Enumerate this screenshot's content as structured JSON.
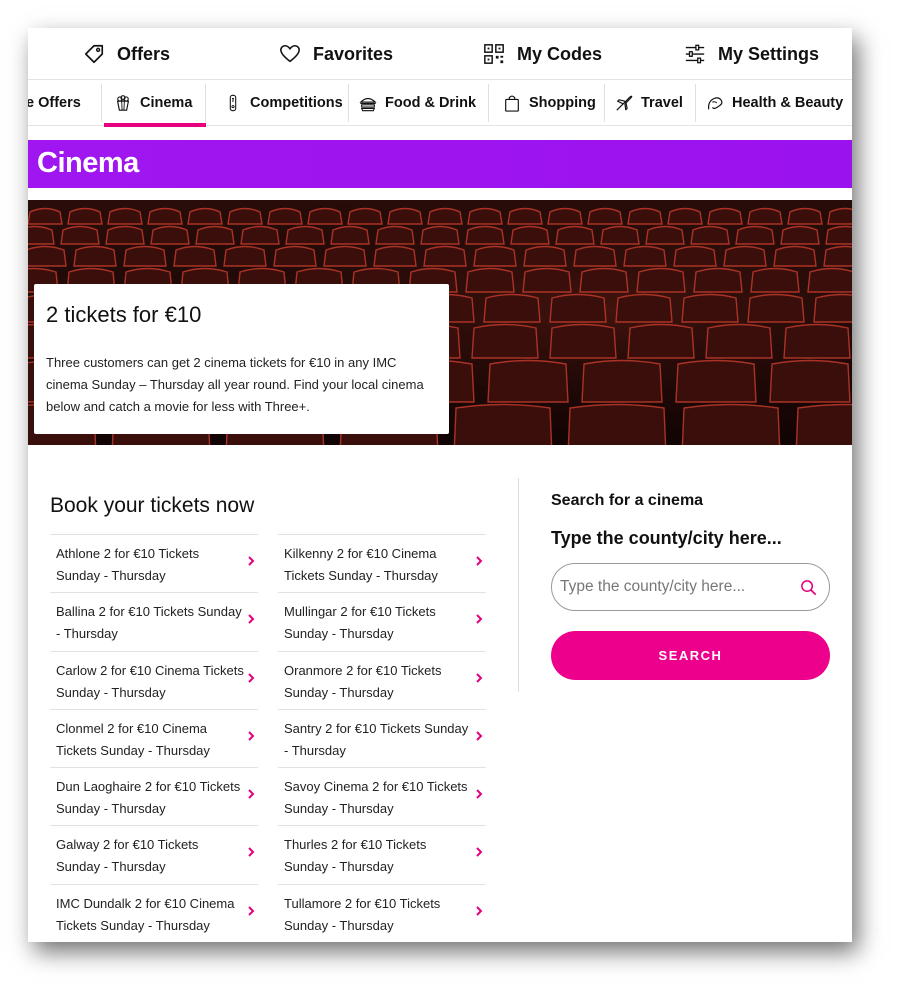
{
  "topnav": {
    "offers": "Offers",
    "favorites": "Favorites",
    "my_codes": "My Codes",
    "my_settings": "My Settings"
  },
  "categories": [
    {
      "label": "e Offers",
      "icon": "tag-icon"
    },
    {
      "label": "Cinema",
      "icon": "popcorn-icon",
      "active": true
    },
    {
      "label": "Competitions",
      "icon": "trophy-icon"
    },
    {
      "label": "Food & Drink",
      "icon": "food-icon"
    },
    {
      "label": "Shopping",
      "icon": "shopping-bag-icon"
    },
    {
      "label": "Travel",
      "icon": "plane-icon"
    },
    {
      "label": "Health & Beauty",
      "icon": "beauty-icon"
    }
  ],
  "page_title": "Cinema",
  "hero": {
    "title": "2 tickets for €10",
    "description": "Three customers can get 2 cinema tickets for €10 in any IMC cinema Sunday – Thursday all year round. Find your local cinema below and catch a movie for less with Three+."
  },
  "book_title": "Book your tickets now",
  "cinemas_left": [
    "Athlone 2 for €10 Tickets Sunday - Thursday",
    "Ballina 2 for €10 Tickets Sunday - Thursday",
    "Carlow 2 for €10 Cinema Tickets Sunday - Thursday",
    "Clonmel 2 for €10 Cinema Tickets Sunday - Thursday",
    "Dun Laoghaire 2 for €10 Tickets Sunday - Thursday",
    "Galway 2 for €10 Tickets Sunday - Thursday",
    "IMC Dundalk 2 for €10 Cinema Tickets Sunday - Thursday"
  ],
  "cinemas_right": [
    "Kilkenny 2 for €10 Cinema Tickets Sunday - Thursday",
    "Mullingar 2 for €10 Tickets Sunday - Thursday",
    "Oranmore 2 for €10 Tickets Sunday - Thursday",
    "Santry 2 for €10 Tickets Sunday - Thursday",
    "Savoy Cinema 2 for €10 Tickets Sunday - Thursday",
    "Thurles 2 for €10 Tickets Sunday - Thursday",
    "Tullamore 2 for €10 Tickets Sunday - Thursday"
  ],
  "search": {
    "heading": "Search for a cinema",
    "label": "Type the county/city here...",
    "placeholder": "Type the county/city here...",
    "button": "SEARCH"
  },
  "colors": {
    "accent": "#e6007e",
    "purple": "#a016f0"
  }
}
